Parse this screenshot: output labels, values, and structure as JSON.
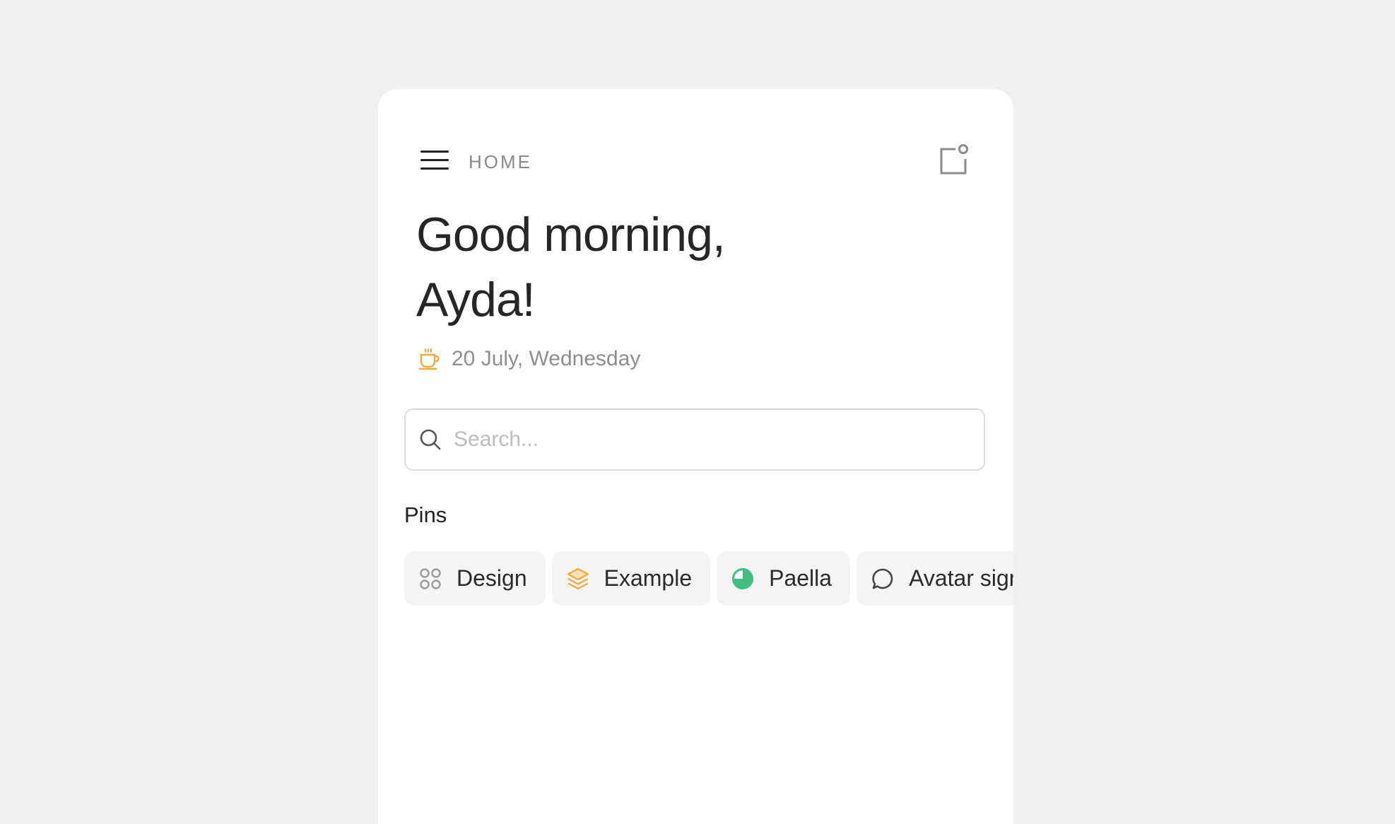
{
  "header": {
    "breadcrumb": "HOME",
    "menu_icon": "hamburger-menu-icon",
    "notification_icon": "notification-square-icon"
  },
  "greeting": {
    "line1": "Good morning,",
    "line2": "Ayda!"
  },
  "date": {
    "icon": "coffee-cup-icon",
    "text": "20 July, Wednesday",
    "icon_color": "#f2a93b"
  },
  "search": {
    "placeholder": "Search...",
    "value": ""
  },
  "pins": {
    "title": "Pins",
    "items": [
      {
        "label": "Design",
        "icon": "grid-icon",
        "color": "#9a9a9a"
      },
      {
        "label": "Example",
        "icon": "layers-icon",
        "color": "#f2a93b"
      },
      {
        "label": "Paella",
        "icon": "pie-chart-icon",
        "color": "#3dbf7f"
      },
      {
        "label": "Avatar sign",
        "icon": "chat-bubble-icon",
        "color": "#444444"
      }
    ]
  }
}
